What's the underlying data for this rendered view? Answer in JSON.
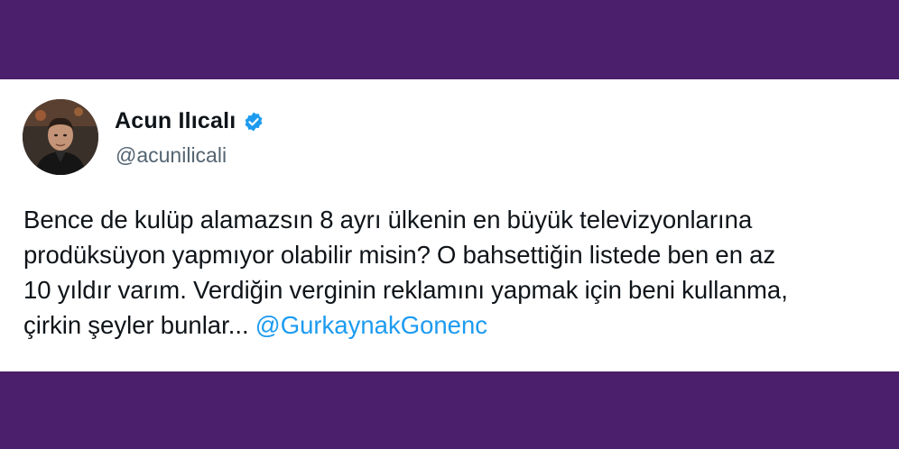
{
  "tweet": {
    "author": {
      "display_name": "Acun Ilıcalı",
      "handle": "@acunilicali",
      "verified": true,
      "avatar_icon": "profile-photo"
    },
    "text": "Bence de kulüp alamazsın 8 ayrı ülkenin en büyük televizyonlarına\nprodüksüyon yapmıyor olabilir misin? O bahsettiğin listede ben en az\n10 yıldır varım. Verdiğin verginin reklamını yapmak için beni kullanma,\nçirkin şeyler bunlar... ",
    "mention": "@GurkaynakGonenc"
  },
  "colors": {
    "background_band": "#4b1f6b",
    "card": "#ffffff",
    "text": "#0f1419",
    "handle": "#536471",
    "link": "#1d9bf0",
    "verified_badge": "#1d9bf0"
  }
}
